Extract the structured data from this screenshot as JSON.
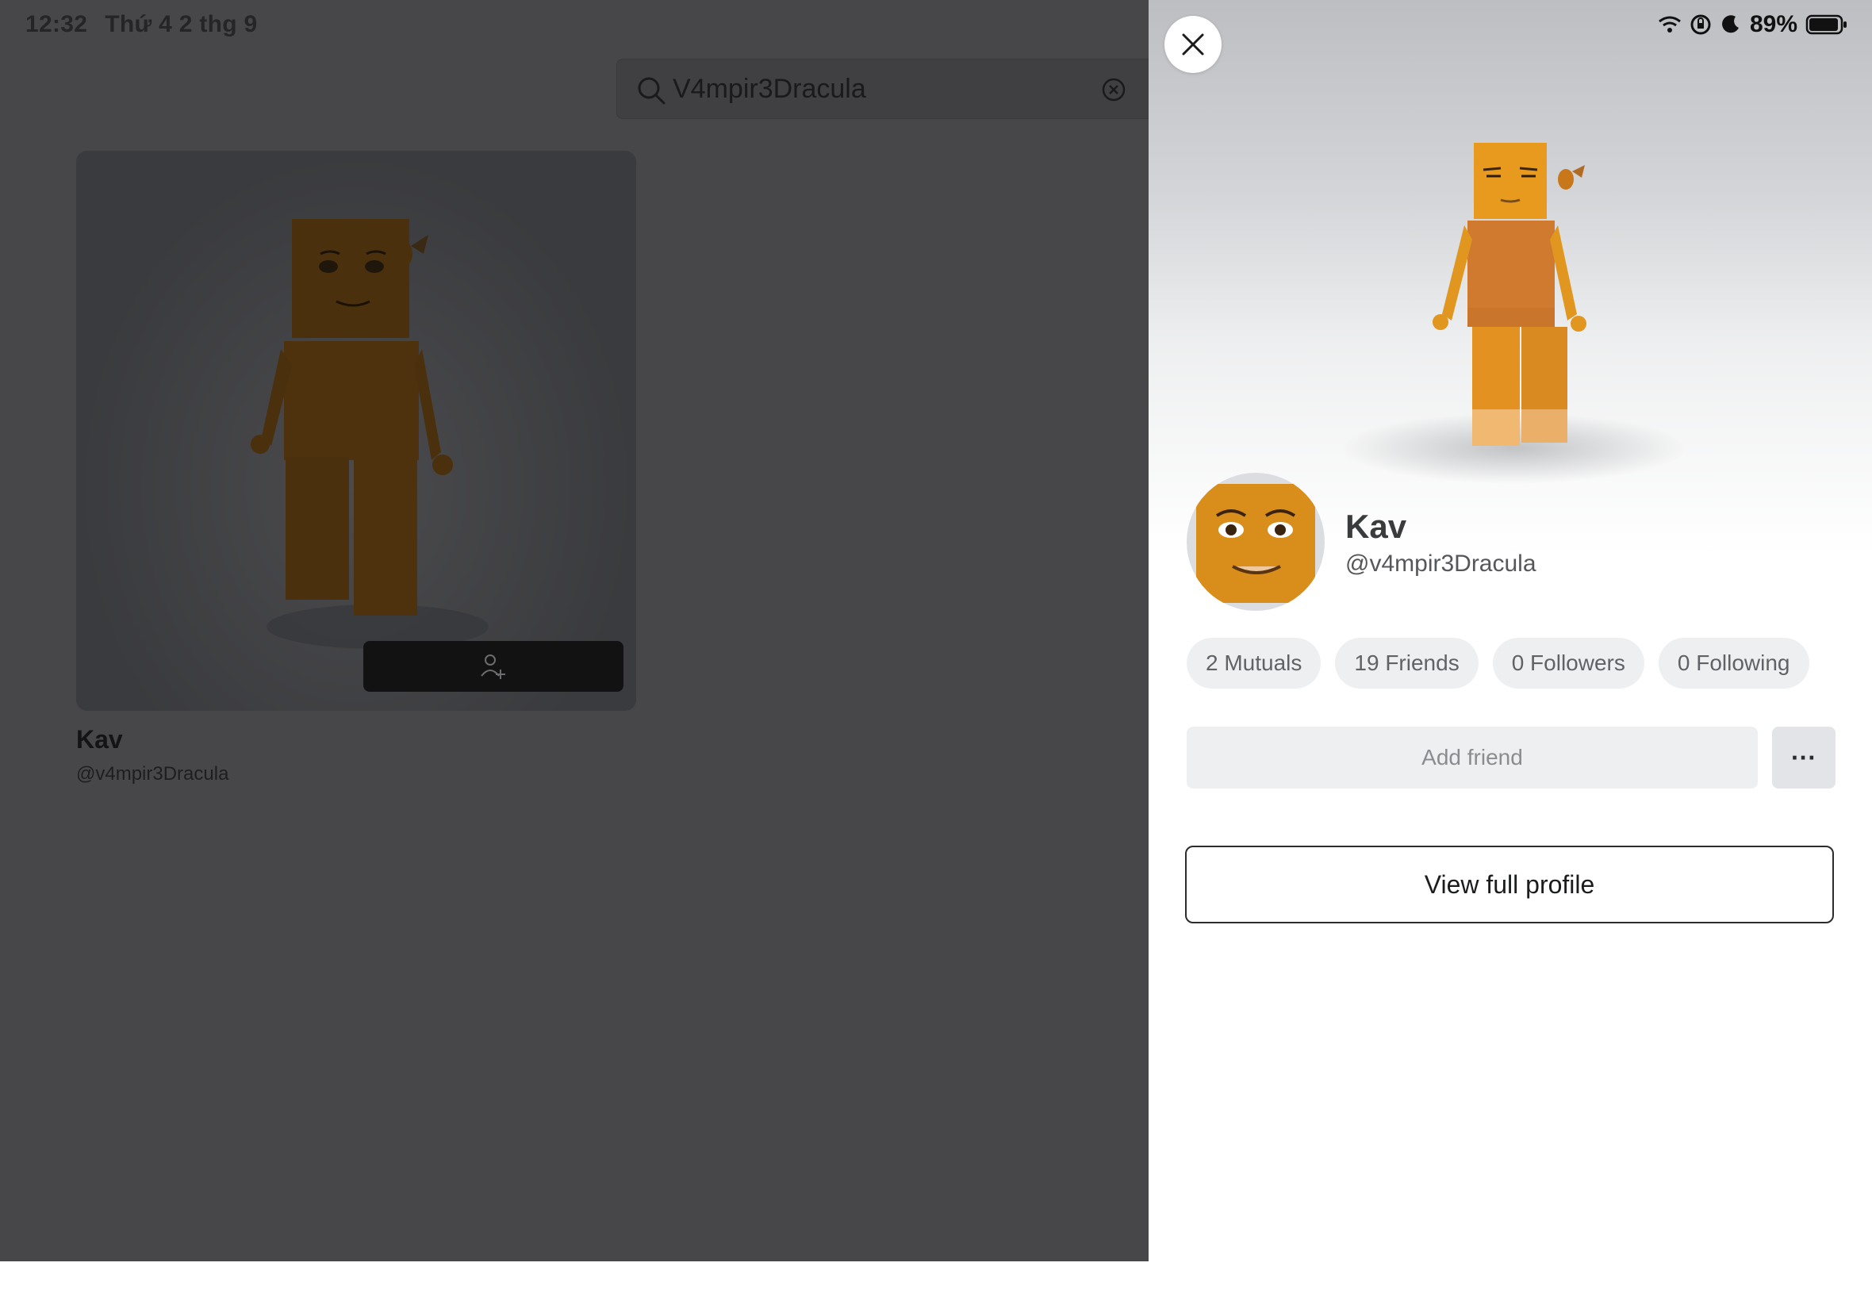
{
  "status_bar": {
    "time": "12:32",
    "date": "Thứ 4 2 thg 9",
    "battery": "89%"
  },
  "search": {
    "query": "V4mpir3Dracula"
  },
  "result_card": {
    "display_name": "Kav",
    "username": "@v4mpir3Dracula"
  },
  "profile": {
    "display_name": "Kav",
    "username": "@v4mpir3Dracula",
    "stats": {
      "mutuals": "2 Mutuals",
      "friends": "19 Friends",
      "followers": "0 Followers",
      "following": "0 Following"
    },
    "add_friend_label": "Add friend",
    "more_label": "···",
    "view_profile_label": "View full profile"
  },
  "colors": {
    "avatar_skin": "#d9901c",
    "overlay": "#474749",
    "panel_bg": "#ffffff"
  }
}
